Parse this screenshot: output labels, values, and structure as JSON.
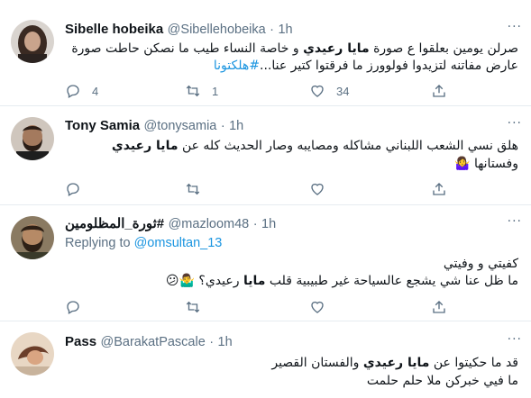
{
  "tweets": [
    {
      "name": "Sibelle hobeika",
      "handle": "@Sibellehobeika",
      "separator": "·",
      "time": "1h",
      "more": "···",
      "line1_pre": "صرلن يومين بعلقوا ع صورة ",
      "line1_bold": "مايا رعيدي",
      "line1_post": " و خاصة النساء طيب ما نصكن حاطت صورة",
      "line2_pre": "عارض مفاتنه لتزيدوا فولوورز ما فرقتوا كتير عنا...",
      "line2_hashtag": "#هلكتونا",
      "reply_count": "4",
      "retweet_count": "1",
      "like_count": "34"
    },
    {
      "name": "Tony Samia",
      "handle": "@tonysamia",
      "separator": "·",
      "time": "1h",
      "more": "···",
      "line1_pre": "هلق نسي الشعب اللبناني مشاكله ومصايبه وصار الحديث كله عن ",
      "line1_bold": "مايا رعيدي",
      "line2": "وفستانها",
      "line2_emoji": "🤷‍♀️",
      "reply_count": "",
      "retweet_count": "",
      "like_count": ""
    },
    {
      "name": "ثورة_المظلومين#",
      "handle": "@mazloom48",
      "separator": "·",
      "time": "1h",
      "more": "···",
      "replying_label": "Replying to",
      "replying_mention": "@omsultan_13",
      "line1": "كفيتي و وفيتي",
      "line2_pre": "ما ظل عنا شي  يشجع عالسياحة غير طبيبية قلب ",
      "line2_bold": "مايا",
      "line2_post": " رعيدي؟",
      "line2_emoji": "🤷‍♂️😕",
      "reply_count": "",
      "retweet_count": "",
      "like_count": ""
    },
    {
      "name": "Pass",
      "handle": "@BarakatPascale",
      "separator": "·",
      "time": "1h",
      "more": "···",
      "line1_pre": "قد ما حكيتوا عن ",
      "line1_bold": "مايا رعيدي",
      "line1_post": " والفستان القصير",
      "line2": "ما فيي خبركن ملا حلم حلمت"
    }
  ],
  "colors": {
    "accent": "#1b95e0",
    "secondary_text": "#5b7083",
    "divider": "#e6ecf0"
  },
  "icons": [
    "reply-icon",
    "retweet-icon",
    "like-icon",
    "share-icon",
    "more-icon"
  ]
}
